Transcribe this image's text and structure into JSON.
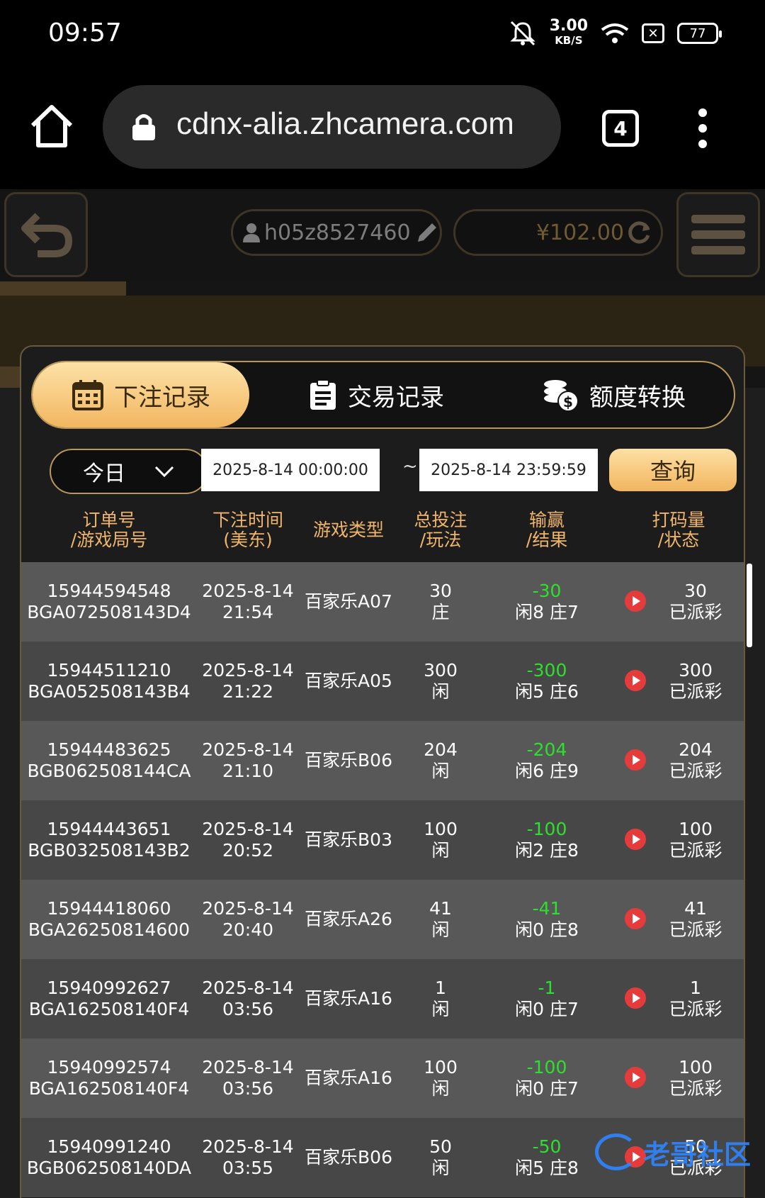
{
  "status": {
    "time": "09:57",
    "speed_value": "3.00",
    "speed_unit": "KB/S",
    "battery": "77"
  },
  "browser": {
    "url": "cdnx-alia.zhcamera.com",
    "tab_count": "4"
  },
  "header": {
    "username": "h05z8527460",
    "balance": "¥102.00"
  },
  "tabs": [
    {
      "label": "下注记录",
      "active": true
    },
    {
      "label": "交易记录",
      "active": false
    },
    {
      "label": "额度转换",
      "active": false
    }
  ],
  "filter": {
    "period": "今日",
    "start": "2025-8-14 00:00:00",
    "separator": "~",
    "end": "2025-8-14 23:59:59",
    "query": "查询"
  },
  "columns": [
    [
      "订单号",
      "/游戏局号"
    ],
    [
      "下注时间",
      "(美东)"
    ],
    [
      "游戏类型"
    ],
    [
      "总投注",
      "/玩法"
    ],
    [
      "输赢",
      "/结果"
    ],
    [
      "打码量",
      "/状态"
    ]
  ],
  "rows": [
    {
      "order": "15944594548",
      "round": "BGA072508143D4",
      "date": "2025-8-14",
      "time": "21:54",
      "game": "百家乐A07",
      "bet": "30",
      "play": "庄",
      "win": "-30",
      "result": "闲8 庄7",
      "valid": "30",
      "status": "已派彩"
    },
    {
      "order": "15944511210",
      "round": "BGA052508143B4",
      "date": "2025-8-14",
      "time": "21:22",
      "game": "百家乐A05",
      "bet": "300",
      "play": "闲",
      "win": "-300",
      "result": "闲5 庄6",
      "valid": "300",
      "status": "已派彩"
    },
    {
      "order": "15944483625",
      "round": "BGB062508144CA",
      "date": "2025-8-14",
      "time": "21:10",
      "game": "百家乐B06",
      "bet": "204",
      "play": "闲",
      "win": "-204",
      "result": "闲6 庄9",
      "valid": "204",
      "status": "已派彩"
    },
    {
      "order": "15944443651",
      "round": "BGB032508143B2",
      "date": "2025-8-14",
      "time": "20:52",
      "game": "百家乐B03",
      "bet": "100",
      "play": "闲",
      "win": "-100",
      "result": "闲2 庄8",
      "valid": "100",
      "status": "已派彩"
    },
    {
      "order": "15944418060",
      "round": "BGA26250814600",
      "date": "2025-8-14",
      "time": "20:40",
      "game": "百家乐A26",
      "bet": "41",
      "play": "闲",
      "win": "-41",
      "result": "闲0 庄8",
      "valid": "41",
      "status": "已派彩"
    },
    {
      "order": "15940992627",
      "round": "BGA162508140F4",
      "date": "2025-8-14",
      "time": "03:56",
      "game": "百家乐A16",
      "bet": "1",
      "play": "闲",
      "win": "-1",
      "result": "闲0 庄7",
      "valid": "1",
      "status": "已派彩"
    },
    {
      "order": "15940992574",
      "round": "BGA162508140F4",
      "date": "2025-8-14",
      "time": "03:56",
      "game": "百家乐A16",
      "bet": "100",
      "play": "闲",
      "win": "-100",
      "result": "闲0 庄7",
      "valid": "100",
      "status": "已派彩"
    },
    {
      "order": "15940991240",
      "round": "BGB062508140DA",
      "date": "2025-8-14",
      "time": "03:55",
      "game": "百家乐B06",
      "bet": "50",
      "play": "闲",
      "win": "-50",
      "result": "闲5 庄8",
      "valid": "50",
      "status": "已派彩"
    }
  ],
  "watermark": "老哥社区",
  "colors": {
    "accent_gold": "#f2b660",
    "negative": "#2ee02e",
    "play_button": "#e53b3b"
  }
}
